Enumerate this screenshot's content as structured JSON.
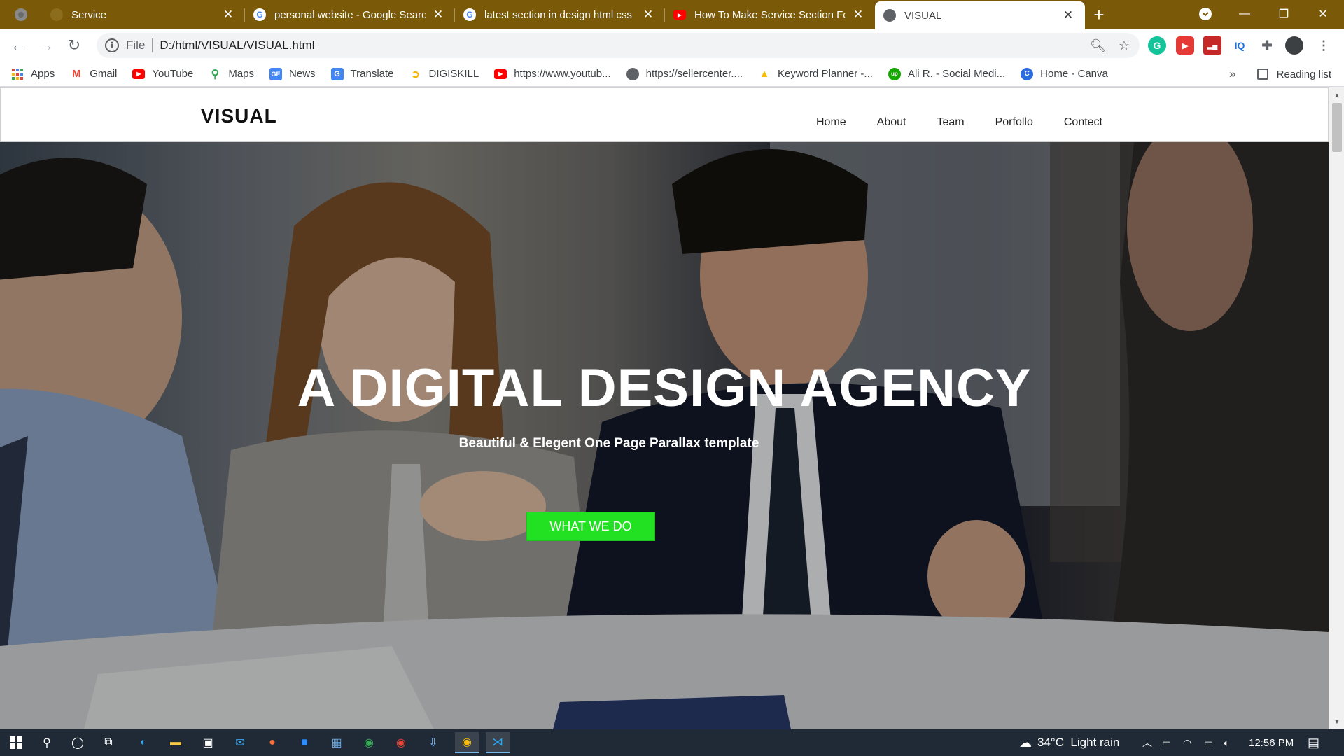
{
  "browser": {
    "tabs": [
      {
        "label": "Service",
        "active": false
      },
      {
        "label": "personal website - Google Search",
        "active": false
      },
      {
        "label": "latest section in design html css",
        "active": false
      },
      {
        "label": "How To Make Service Section For",
        "active": false
      },
      {
        "label": "VISUAL",
        "active": true
      }
    ],
    "address": {
      "scheme": "File",
      "url": "D:/html/VISUAL/VISUAL.html"
    },
    "bookmarks": [
      {
        "label": "Apps",
        "icon": "apps-grid-icon",
        "color": "#ea4335"
      },
      {
        "label": "Gmail",
        "icon": "gmail-icon",
        "color": "#ea4335"
      },
      {
        "label": "YouTube",
        "icon": "youtube-icon",
        "color": "#ff0000"
      },
      {
        "label": "Maps",
        "icon": "maps-icon",
        "color": "#34a853"
      },
      {
        "label": "News",
        "icon": "news-icon",
        "color": "#4285f4"
      },
      {
        "label": "Translate",
        "icon": "translate-icon",
        "color": "#4285f4"
      },
      {
        "label": "DIGISKILL",
        "icon": "digiskill-icon",
        "color": "#f4b400"
      },
      {
        "label": "https://www.youtub...",
        "icon": "youtube-icon",
        "color": "#ff0000"
      },
      {
        "label": "https://sellercenter....",
        "icon": "globe-icon",
        "color": "#5f6368"
      },
      {
        "label": "Keyword Planner -...",
        "icon": "google-ads-icon",
        "color": "#fbbc04"
      },
      {
        "label": "Ali R. - Social Medi...",
        "icon": "upwork-icon",
        "color": "#14a800"
      },
      {
        "label": "Home - Canva",
        "icon": "canva-icon",
        "color": "#2d6cdf"
      }
    ],
    "more_bookmarks": "»",
    "reading_list": "Reading list"
  },
  "site": {
    "logo": "VISUAL",
    "nav": [
      "Home",
      "About",
      "Team",
      "Porfollo",
      "Contect"
    ],
    "hero": {
      "title": "A DIGITAL DESIGN AGENCY",
      "subtitle": "Beautiful & Elegent One Page Parallax template",
      "cta": "WHAT WE DO"
    },
    "accent": "#22e022"
  },
  "taskbar": {
    "weather": "34°C  Light rain",
    "time": "12:56 PM"
  }
}
